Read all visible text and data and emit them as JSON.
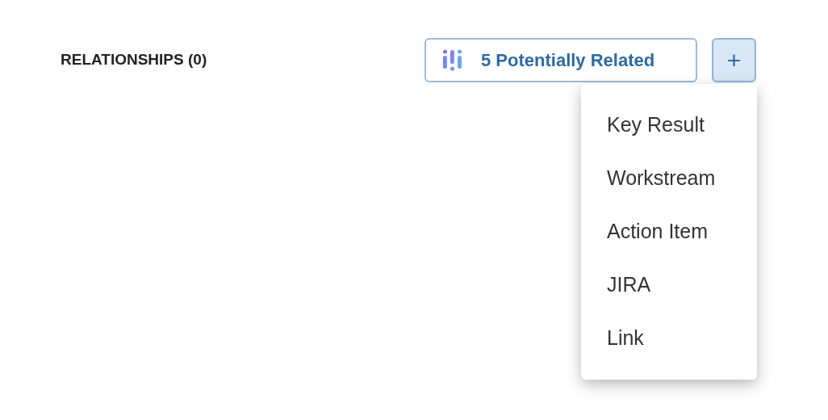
{
  "section": {
    "title": "RELATIONSHIPS (0)"
  },
  "related_button": {
    "label": "5 Potentially Related"
  },
  "add_button": {
    "label": "+",
    "expanded": true
  },
  "menu": {
    "items": [
      {
        "label": "Key Result"
      },
      {
        "label": "Workstream"
      },
      {
        "label": "Action Item"
      },
      {
        "label": "JIRA"
      },
      {
        "label": "Link"
      }
    ]
  }
}
